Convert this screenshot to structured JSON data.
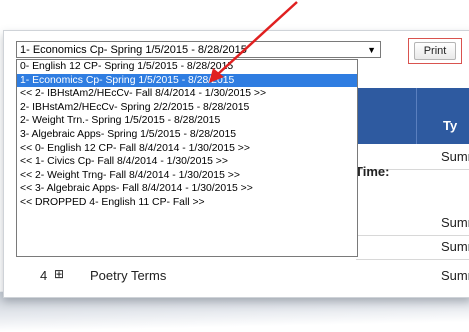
{
  "select": {
    "value": "1- Economics Cp- Spring 1/5/2015 - 8/28/2015",
    "options": [
      "0- English 12 CP- Spring 1/5/2015 - 8/28/2015",
      "1- Economics Cp- Spring 1/5/2015 - 8/28/2015",
      "<< 2- IBHstAm2/HEcCv- Fall 8/4/2014 - 1/30/2015 >>",
      "2- IBHstAm2/HEcCv- Spring 2/2/2015 - 8/28/2015",
      "2- Weight Trn.- Spring 1/5/2015 - 8/28/2015",
      "3- Algebraic Apps- Spring 1/5/2015 - 8/28/2015",
      "<< 0- English 12 CP- Fall 8/4/2014 - 1/30/2015 >>",
      "<< 1- Civics Cp- Fall 8/4/2014 - 1/30/2015 >>",
      "<< 2- Weight Trng- Fall 8/4/2014 - 1/30/2015 >>",
      "<< 3- Algebraic Apps- Fall 8/4/2014 - 1/30/2015 >>",
      "<< DROPPED 4- English 11 CP- Fall >>"
    ],
    "selected_index": 1
  },
  "toolbar": {
    "print_label": "Print"
  },
  "table": {
    "header_partial": "Ty",
    "summary_cells": [
      "Sumr",
      "Sumr",
      "Sumr",
      "Sumr"
    ],
    "time_label": "Time:",
    "last_row": {
      "number": "4",
      "expand_symbol": "⊞",
      "title": "Poetry Terms",
      "type": "Sumr"
    }
  },
  "colors": {
    "highlight": "#2f7de1",
    "header_blue": "#2e5aa0",
    "arrow_red": "#e02020",
    "print_border": "#d9534f"
  }
}
